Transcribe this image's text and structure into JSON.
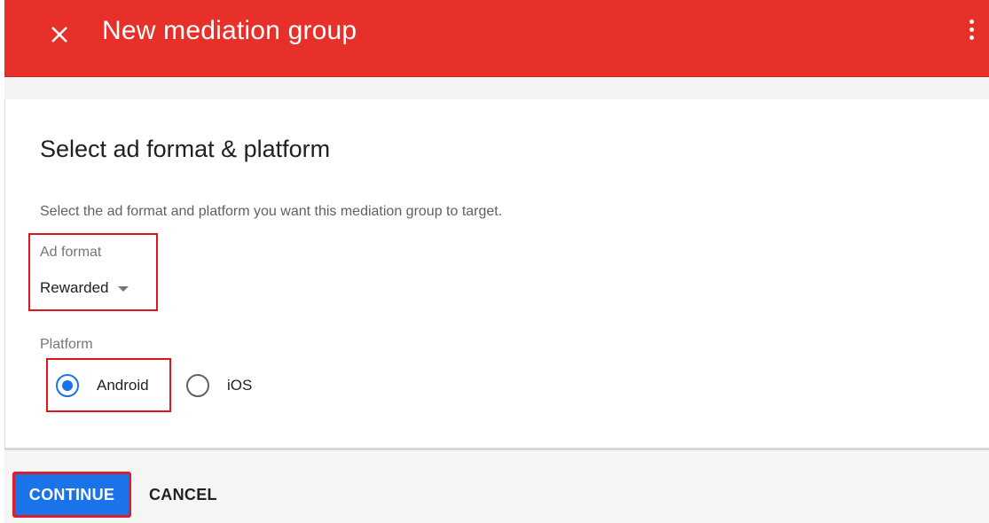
{
  "header": {
    "title": "New mediation group",
    "close_icon": "close-icon",
    "more_icon": "more-vert-icon",
    "color": "#e8302a"
  },
  "main": {
    "heading": "Select ad format & platform",
    "description": "Select the ad format and platform you want this mediation group to target.",
    "ad_format": {
      "label": "Ad format",
      "value": "Rewarded"
    },
    "platform": {
      "label": "Platform",
      "options": [
        {
          "label": "Android",
          "selected": true
        },
        {
          "label": "iOS",
          "selected": false
        }
      ]
    }
  },
  "footer": {
    "continue_label": "CONTINUE",
    "cancel_label": "CANCEL",
    "primary_color": "#1a73e8"
  },
  "highlight_color": "#e0141e"
}
